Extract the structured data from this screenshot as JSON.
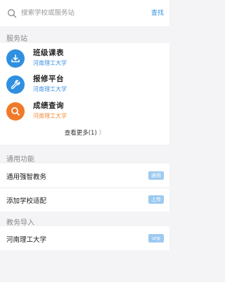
{
  "search": {
    "placeholder": "搜索学校或服务站",
    "button_label": "查找"
  },
  "service_station": {
    "title": "服务站",
    "items": [
      {
        "name": "班级课表",
        "school": "河南理工大学",
        "icon": "download-icon",
        "color": "#2f8fe0"
      },
      {
        "name": "报修平台",
        "school": "河南理工大学",
        "icon": "wrench-icon",
        "color": "#2f8fe0"
      },
      {
        "name": "成绩查询",
        "school": "河南理工大学",
        "icon": "search-icon",
        "color": "#ef7b2a"
      }
    ],
    "more_label": "查看更多(1)",
    "more_chevron": "〉"
  },
  "general": {
    "title": "通用功能",
    "items": [
      {
        "label": "通用强智教务",
        "badge": "通用"
      },
      {
        "label": "添加学校适配",
        "badge": "上传"
      }
    ]
  },
  "import": {
    "title": "教务导入",
    "items": [
      {
        "label": "河南理工大学",
        "badge": "urp"
      }
    ]
  }
}
